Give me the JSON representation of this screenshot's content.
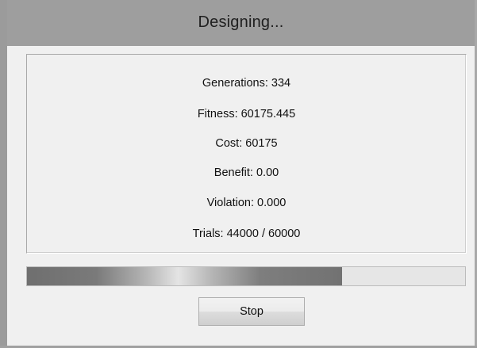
{
  "window": {
    "title": "Designing..."
  },
  "stats": {
    "generations": "Generations: 334",
    "fitness": "Fitness: 60175.445",
    "cost": "Cost: 60175",
    "benefit": "Benefit: 0.00",
    "violation": "Violation: 0.000",
    "trials": "Trials: 44000 / 60000"
  },
  "progress": {
    "value": 0.72
  },
  "buttons": {
    "stop_label": "Stop"
  }
}
